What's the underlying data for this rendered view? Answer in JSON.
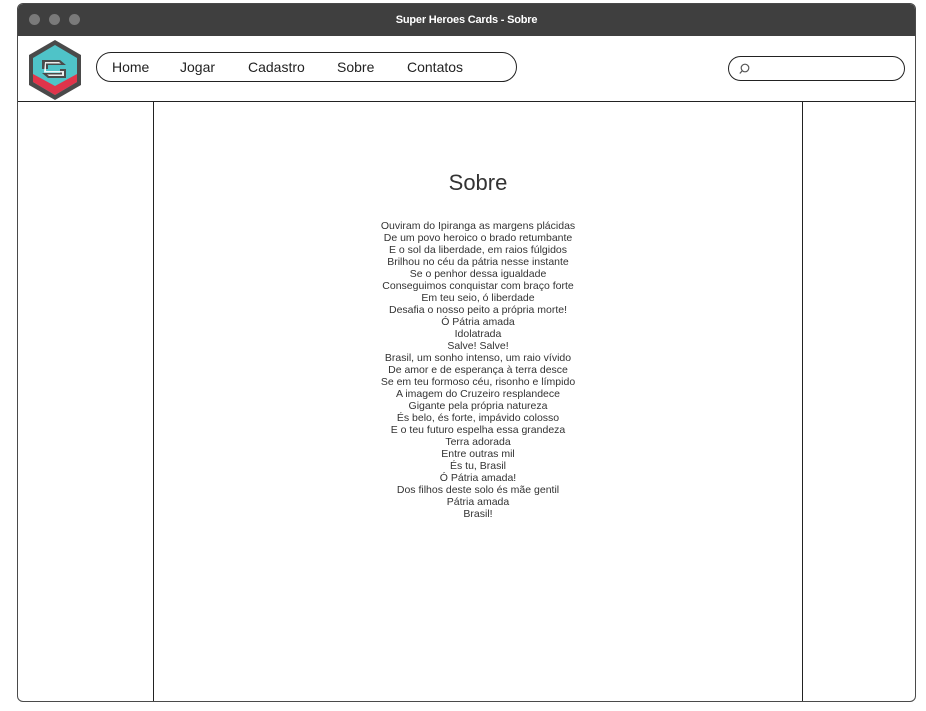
{
  "window": {
    "title": "Super Heroes Cards - Sobre"
  },
  "header": {
    "logo_icon": "hexagon-s-logo-icon",
    "nav": [
      {
        "label": "Home"
      },
      {
        "label": "Jogar"
      },
      {
        "label": "Cadastro"
      },
      {
        "label": "Sobre"
      },
      {
        "label": "Contatos"
      }
    ],
    "search": {
      "icon": "search-icon",
      "value": "",
      "placeholder": ""
    }
  },
  "main": {
    "title": "Sobre",
    "lines": [
      "Ouviram do Ipiranga as margens plácidas",
      "De um povo heroico o brado retumbante",
      "E o sol da liberdade, em raios fúlgidos",
      "Brilhou no céu da pátria nesse instante",
      "Se o penhor dessa igualdade",
      "Conseguimos conquistar com braço forte",
      "Em teu seio, ó liberdade",
      "Desafia o nosso peito a própria morte!",
      "Ó Pátria amada",
      "Idolatrada",
      "Salve! Salve!",
      "Brasil, um sonho intenso, um raio vívido",
      "De amor e de esperança à terra desce",
      "Se em teu formoso céu, risonho e límpido",
      "A imagem do Cruzeiro resplandece",
      "Gigante pela própria natureza",
      "És belo, és forte, impávido colosso",
      "E o teu futuro espelha essa grandeza",
      "Terra adorada",
      "Entre outras mil",
      "És tu, Brasil",
      "Ó Pátria amada!",
      "Dos filhos deste solo és mãe gentil",
      "Pátria amada",
      "Brasil!"
    ]
  },
  "colors": {
    "titlebar": "#3f3f3f",
    "logo_teal": "#4fc3c8",
    "logo_red": "#e0344a",
    "logo_gray": "#4a4a4a"
  }
}
